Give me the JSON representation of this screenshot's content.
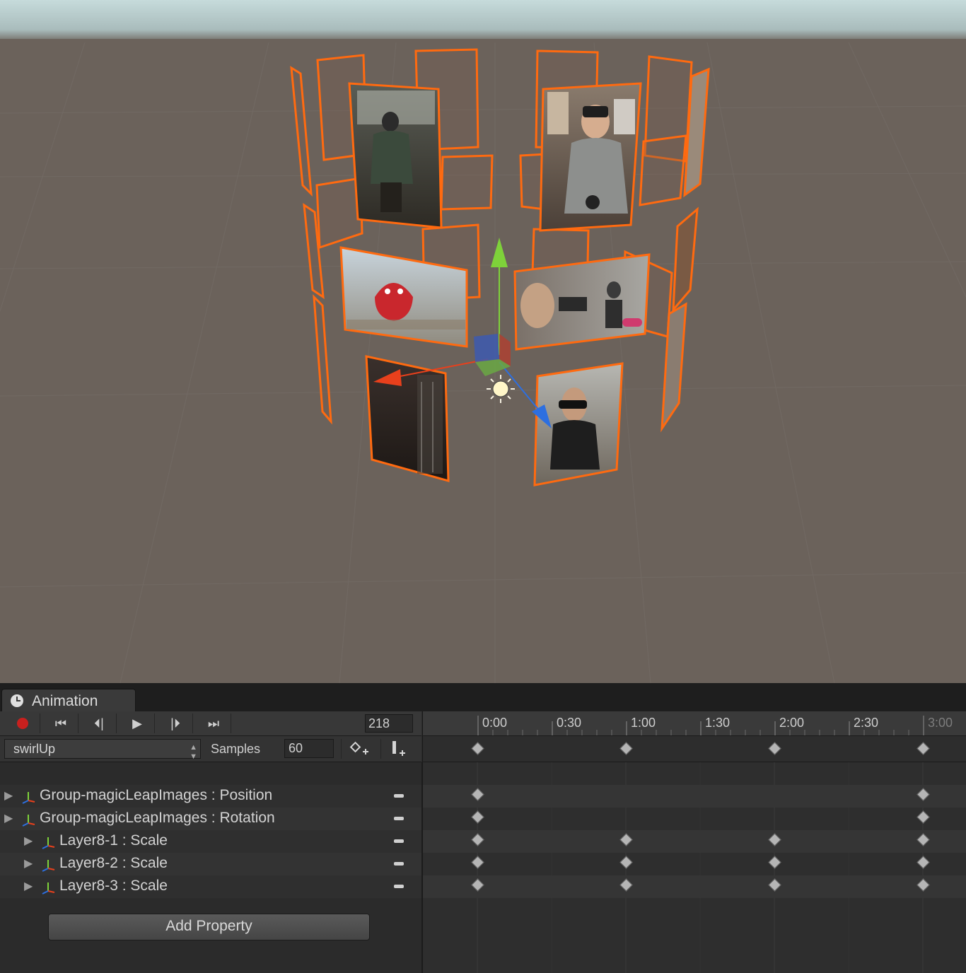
{
  "scene": {
    "sky_color": "#bfd5d6",
    "ground_color": "#6b625b",
    "selection_outline_color": "#ff6a10",
    "gizmo": {
      "y_axis_color": "#7ed23a",
      "x_axis_color": "#e8401c",
      "z_axis_color": "#2d6fe0",
      "light_icon": "sun-icon"
    },
    "photo_panels": [
      "person-with-headset",
      "person-with-glasses-holding-controller",
      "red-mascot-on-sky",
      "people-at-trade-show",
      "dark-hallway",
      "man-with-glasses"
    ]
  },
  "animation": {
    "tab_label": "Animation",
    "tab_icon": "clock-icon",
    "toolbar": {
      "record_icon": "record-icon",
      "first_frame_icon": "first-key-icon",
      "prev_frame_icon": "prev-key-icon",
      "play_icon": "play-icon",
      "next_frame_icon": "next-key-icon",
      "last_frame_icon": "last-key-icon",
      "frame": "218"
    },
    "timeline": {
      "labels": [
        "0:00",
        "0:30",
        "1:00",
        "1:30",
        "2:00",
        "2:30",
        "3:00"
      ]
    },
    "clip": {
      "name": "swirlUp",
      "samples_label": "Samples",
      "samples_value": "60",
      "add_keyframe_icon": "add-keyframe-icon",
      "add_event_icon": "add-event-icon"
    },
    "properties": [
      {
        "label": "Group-magicLeapImages : Position",
        "indent": 0,
        "keys": [
          "0:00",
          "3:00"
        ]
      },
      {
        "label": "Group-magicLeapImages : Rotation",
        "indent": 0,
        "keys": [
          "0:00",
          "3:00"
        ]
      },
      {
        "label": "Layer8-1 : Scale",
        "indent": 1,
        "keys": [
          "0:00",
          "1:00",
          "2:00",
          "3:00"
        ]
      },
      {
        "label": "Layer8-2 : Scale",
        "indent": 1,
        "keys": [
          "0:00",
          "1:00",
          "2:00",
          "3:00"
        ]
      },
      {
        "label": "Layer8-3 : Scale",
        "indent": 1,
        "keys": [
          "0:00",
          "1:00",
          "2:00",
          "3:00"
        ]
      }
    ],
    "summary_keys": [
      "0:00",
      "1:00",
      "2:00",
      "3:00"
    ],
    "add_property_label": "Add Property"
  }
}
